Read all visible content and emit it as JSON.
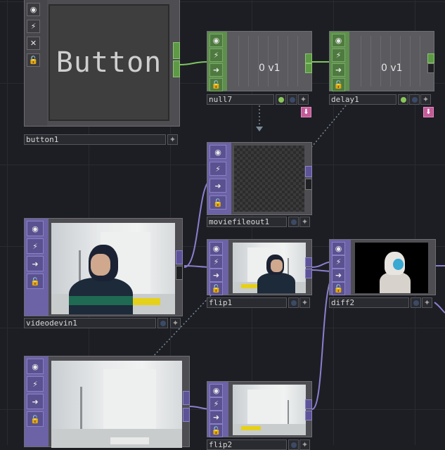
{
  "nodes": {
    "button1": {
      "name": "button1",
      "display_text": "Button"
    },
    "null7": {
      "name": "null7",
      "value": "0 v1"
    },
    "delay1": {
      "name": "delay1",
      "value": "0 v1"
    },
    "moviefileout1": {
      "name": "moviefileout1"
    },
    "videodevin1": {
      "name": "videodevin1"
    },
    "flip1": {
      "name": "flip1"
    },
    "diff2": {
      "name": "diff2"
    },
    "flip2": {
      "name": "flip2"
    }
  },
  "icons": {
    "viewer": "viewer-icon",
    "bypass": "bypass-icon",
    "close": "close-icon",
    "cook": "cook-icon",
    "lock": "lock-icon",
    "plus": "plus-icon",
    "arrow": "arrow-down-icon"
  },
  "colors": {
    "chop_family": "#5e8f4c",
    "top_family": "#6c62a6",
    "wire_green": "#7ec462",
    "wire_purple": "#8a7fd0",
    "background": "#1d1e23"
  }
}
